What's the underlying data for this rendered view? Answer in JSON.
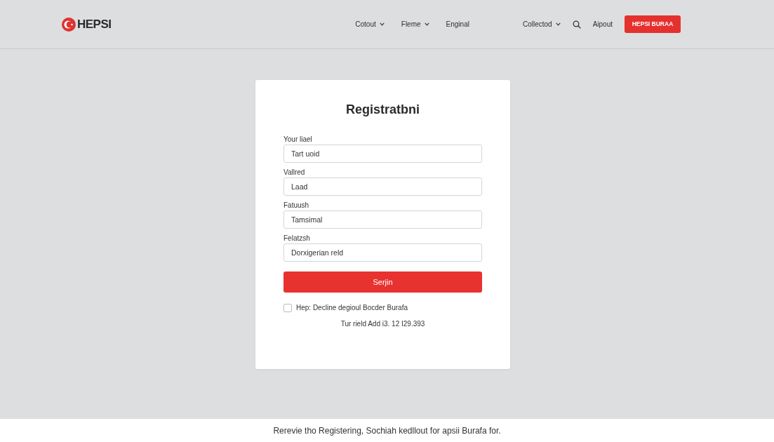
{
  "header": {
    "logo": {
      "text": "HEPSI"
    },
    "nav": [
      {
        "kind": "dropdown",
        "label": "Cotout"
      },
      {
        "kind": "dropdown",
        "label": "Fleme"
      },
      {
        "kind": "link",
        "label": "Enginal"
      }
    ],
    "nav_right": [
      {
        "kind": "dropdown",
        "label": "Collectod"
      },
      {
        "kind": "search"
      },
      {
        "kind": "link",
        "label": "Aipout"
      }
    ],
    "cta_button": "HEPSI BURAA"
  },
  "form": {
    "title": "Registratbni",
    "fields": [
      {
        "label": "Your liael",
        "value": "Tart uoid"
      },
      {
        "label": "Vallred",
        "value": "Laad"
      },
      {
        "label": "Fatuush",
        "value": "Tamsimal"
      },
      {
        "label": "Felatzsh",
        "value": "Dorxigerian reld"
      }
    ],
    "submit_button": "Serjin",
    "consent": {
      "checked": false,
      "label": "Hep: Decline degioul Bocder Burafa"
    },
    "note": "Tur rield Add i3. 12 I29.393"
  },
  "footer": {
    "text": "Rerevie tho Registering, Sochiah kedllout for apsii Burafa for."
  }
}
